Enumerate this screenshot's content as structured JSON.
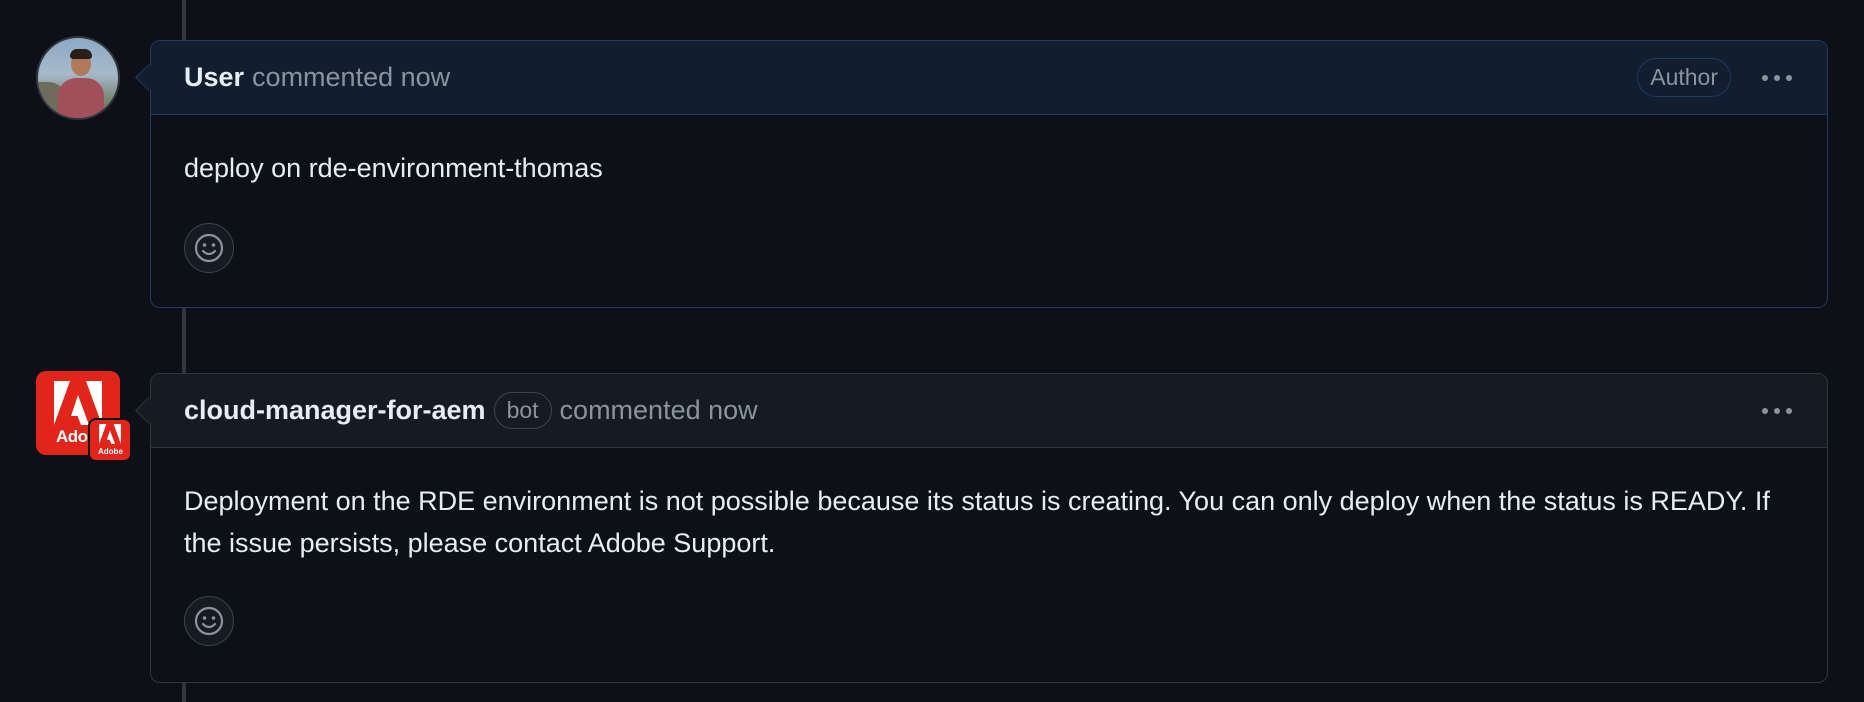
{
  "comments": [
    {
      "author": "User",
      "meta": "commented now",
      "badge": "Author",
      "body": "deploy on rde-environment-thomas",
      "avatar_icon": "user-photo"
    },
    {
      "author": "cloud-manager-for-aem",
      "bot_label": "bot",
      "meta": "commented now",
      "body": "Deployment on the RDE environment is not possible because its status is creating. You can only deploy when the status is READY. If the issue persists, please contact Adobe Support.",
      "avatar_icon": "adobe-logo",
      "avatar_text": "Adobe",
      "badge_text": "Adobe"
    }
  ],
  "icons": {
    "more": "kebab-horizontal-icon",
    "reaction": "smiley-icon"
  },
  "colors": {
    "background": "#0d1117",
    "header": "#151b23",
    "author_header": "#121d2f",
    "author_border": "#1f3a66",
    "border": "#30363d",
    "text": "#e6edf3",
    "muted": "#8b949e",
    "adobe_red": "#e1251b"
  }
}
